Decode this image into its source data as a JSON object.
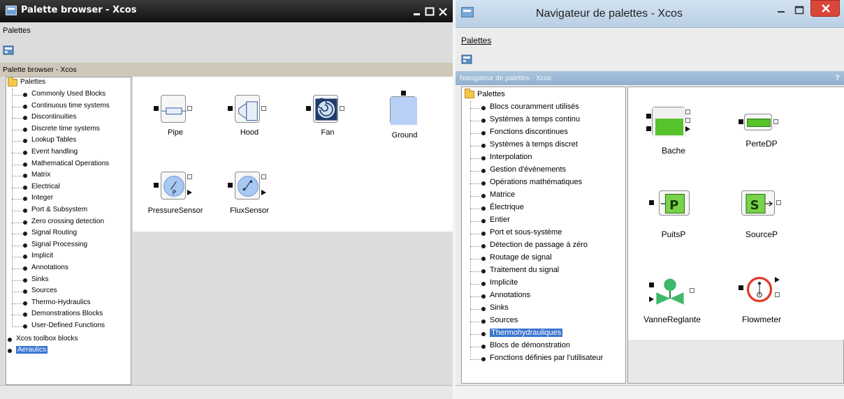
{
  "left_window": {
    "title": "Palette browser - Xcos",
    "controls": {
      "minimize": "_",
      "maximize": "□",
      "close": "✕"
    },
    "menu": [
      "Palettes"
    ],
    "toolbar_icon": "palette-file-icon",
    "panel_title": "Palette browser - Xcos",
    "tree_root": "Palettes",
    "tree_items": [
      "Commonly Used Blocks",
      "Continuous time systems",
      "Discontinuities",
      "Discrete time systems",
      "Lookup Tables",
      "Event handling",
      "Mathematical Operations",
      "Matrix",
      "Electrical",
      "Integer",
      "Port & Subsystem",
      "Zero crossing detection",
      "Signal Routing",
      "Signal Processing",
      "Implicit",
      "Annotations",
      "Sinks",
      "Sources",
      "Thermo-Hydraulics",
      "Demonstrations Blocks",
      "User-Defined Functions"
    ],
    "extra_roots": [
      "Xcos toolbox blocks",
      "Aeraulics"
    ],
    "selected": "Aeraulics",
    "blocks": [
      "Pipe",
      "Hood",
      "Fan",
      "Ground",
      "PressureSensor",
      "FluxSensor"
    ]
  },
  "right_window": {
    "title": "Navigateur de palettes - Xcos",
    "controls": {
      "minimize": "–",
      "maximize": "□",
      "close": "✕"
    },
    "menu": [
      "Palettes"
    ],
    "toolbar_icon": "palette-file-icon",
    "panel_title": "Navigateur de palettes - Xcos",
    "panel_help": "?",
    "tree_root": "Palettes",
    "tree_items": [
      "Blocs couramment utilisés",
      "Systèmes à temps continu",
      "Fonctions discontinues",
      "Systèmes à temps discret",
      "Interpolation",
      "Gestion d'événements",
      "Opérations mathématiques",
      "Matrice",
      "Électrique",
      "Entier",
      "Port et sous-système",
      "Détection de passage à zéro",
      "Routage de signal",
      "Traitement du signal",
      "Implicite",
      "Annotations",
      "Sinks",
      "Sources",
      "Thermohydrauliques",
      "Blocs de démonstration",
      "Fonctions définies par l'utilisateur"
    ],
    "selected": "Thermohydrauliques",
    "blocks": [
      "Bache",
      "PerteDP",
      "PuitsP",
      "SourceP",
      "VanneReglante",
      "Flowmeter"
    ]
  },
  "colors": {
    "selection": "#3a74d0",
    "bache_fill": "#57c32a",
    "flowmeter_ring": "#e23b2b",
    "close_button": "#d9463a"
  }
}
